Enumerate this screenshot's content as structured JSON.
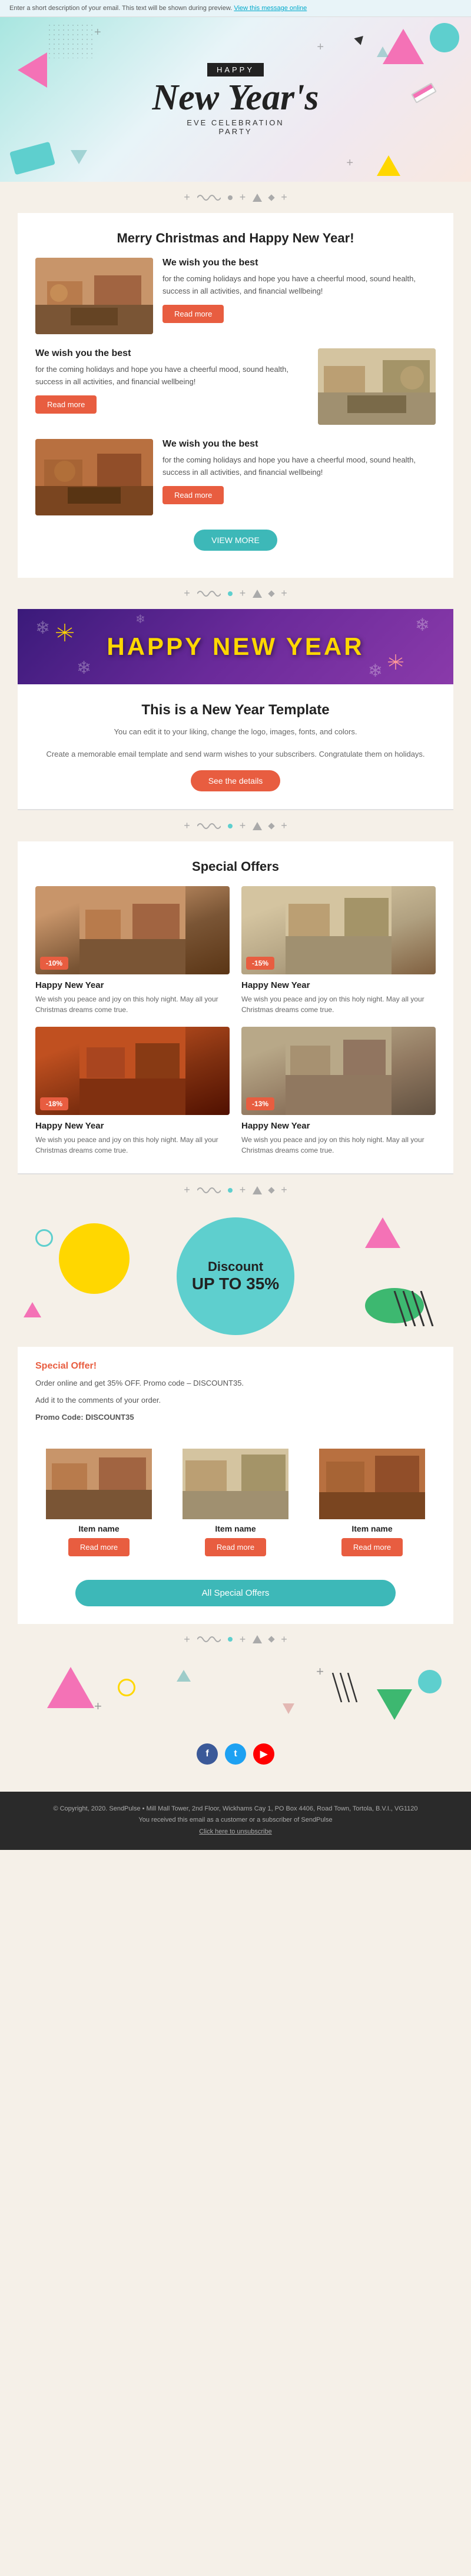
{
  "preview_bar": {
    "text": "Enter a short description of your email. This text will be shown during preview.",
    "link_text": "View this message online"
  },
  "hero": {
    "happy_label": "HAPPY",
    "main_title": "New Year's",
    "subtitle": "EVE CELEBRATION",
    "subtitle2": "PARTY"
  },
  "section1": {
    "heading": "Merry Christmas and Happy New Year!",
    "block1": {
      "title": "We wish you the best",
      "text": "for the coming holidays and hope you have a cheerful mood, sound health, success in all activities, and financial wellbeing!",
      "button": "Read more"
    },
    "block2": {
      "title": "We wish you the best",
      "text": "for the coming holidays and hope you have a cheerful mood, sound health, success in all activities, and financial wellbeing!",
      "button": "Read more"
    },
    "block3": {
      "title": "We wish you the best",
      "text": "for the coming holidays and hope you have a cheerful mood, sound health, success in all activities, and financial wellbeing!",
      "button": "Read more"
    },
    "view_more": "VIEW MORE"
  },
  "ny_banner": {
    "text": "HAPPY NEW YEAR"
  },
  "template_section": {
    "title": "This is a New Year Template",
    "text1": "You can edit it to your liking, change the logo, images, fonts, and colors.",
    "text2": "Create a memorable email template and send warm wishes to your subscribers. Congratulate them on holidays.",
    "button": "See the details"
  },
  "special_offers": {
    "title": "Special Offers",
    "offer1": {
      "title": "Happy New Year",
      "text": "We wish you peace and joy on this holy night. May all your Christmas dreams come true.",
      "badge": "-10%"
    },
    "offer2": {
      "title": "Happy New Year",
      "text": "We wish you peace and joy on this holy night. May all your Christmas dreams come true.",
      "badge": "-15%"
    },
    "offer3": {
      "title": "Happy New Year",
      "text": "We wish you peace and joy on this holy night. May all your Christmas dreams come true.",
      "badge": "-18%"
    },
    "offer4": {
      "title": "Happy New Year",
      "text": "We wish you peace and joy on this holy night. May all your Christmas dreams come true.",
      "badge": "-13%"
    }
  },
  "discount_section": {
    "text1": "Discount",
    "text2": "UP TO 35%"
  },
  "special_offer_text": {
    "heading": "Special Offer!",
    "line1": "Order online and get 35% OFF. Promo code – DISCOUNT35.",
    "line2": "Add it to the comments of your order.",
    "promo_label": "Promo Code: DISCOUNT35"
  },
  "items": {
    "title": "",
    "items": [
      {
        "name": "Item name",
        "button": "Read more"
      },
      {
        "name": "Item name",
        "button": "Read more"
      },
      {
        "name": "Item name",
        "button": "Read more"
      }
    ]
  },
  "all_offers_button": "All Special Offers",
  "footer": {
    "social": {
      "facebook": "f",
      "twitter": "t",
      "youtube": "▶"
    },
    "copyright": "© Copyright, 2020. SendPulse • Mill Mall Tower, 2nd Floor, Wickhams Cay 1, PO Box 4406, Road Town, Tortola, B.V.I., VG1120",
    "disclaimer": "You received this email as a customer or a subscriber of SendPulse",
    "unsubscribe": "Click here to unsubscribe"
  }
}
